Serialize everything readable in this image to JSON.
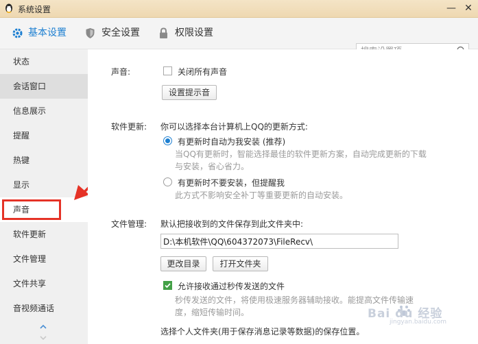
{
  "window": {
    "title": "系统设置",
    "minimize": "—",
    "close": "✕"
  },
  "tabs": [
    {
      "label": "基本设置",
      "icon": "gear-icon"
    },
    {
      "label": "安全设置",
      "icon": "shield-icon"
    },
    {
      "label": "权限设置",
      "icon": "lock-icon"
    }
  ],
  "search": {
    "placeholder": "搜索设置项"
  },
  "sidebar": {
    "items": [
      "状态",
      "会话窗口",
      "信息展示",
      "提醒",
      "热键",
      "显示",
      "声音",
      "软件更新",
      "文件管理",
      "文件共享",
      "音视频通话"
    ]
  },
  "sound": {
    "label": "声音:",
    "mute_all": "关闭所有声音",
    "set_tone_button": "设置提示音"
  },
  "update": {
    "label": "软件更新:",
    "intro": "你可以选择本台计算机上QQ的更新方式:",
    "option_auto": "有更新时自动为我安装 (推荐)",
    "option_auto_desc_1": "当QQ有更新时，智能选择最佳的软件更新方案，自动完成更新的下载",
    "option_auto_desc_2": "与安装，省心省力。",
    "option_notify": "有更新时不要安装，但提醒我",
    "option_notify_desc": "此方式不影响安全补丁等重要更新的自动安装。"
  },
  "files": {
    "label": "文件管理:",
    "intro": "默认把接收到的文件保存到此文件夹中:",
    "path": "D:\\本机软件\\QQ\\604372073\\FileRecv\\",
    "change_dir_button": "更改目录",
    "open_folder_button": "打开文件夹",
    "allow_flash": "允许接收通过秒传发送的文件",
    "allow_flash_desc_1": "秒传发送的文件，将使用极速服务器辅助接收。能提高文件传输速",
    "allow_flash_desc_2": "度，缩短传输时间。",
    "personal_folder": "选择个人文件夹(用于保存消息记录等数据)的保存位置。"
  },
  "watermark": {
    "text": "Bai du 经验",
    "url": "jingyan.baidu.com"
  },
  "colors": {
    "accent": "#1d7fd1",
    "highlight": "#e53226",
    "check": "#43a047"
  }
}
